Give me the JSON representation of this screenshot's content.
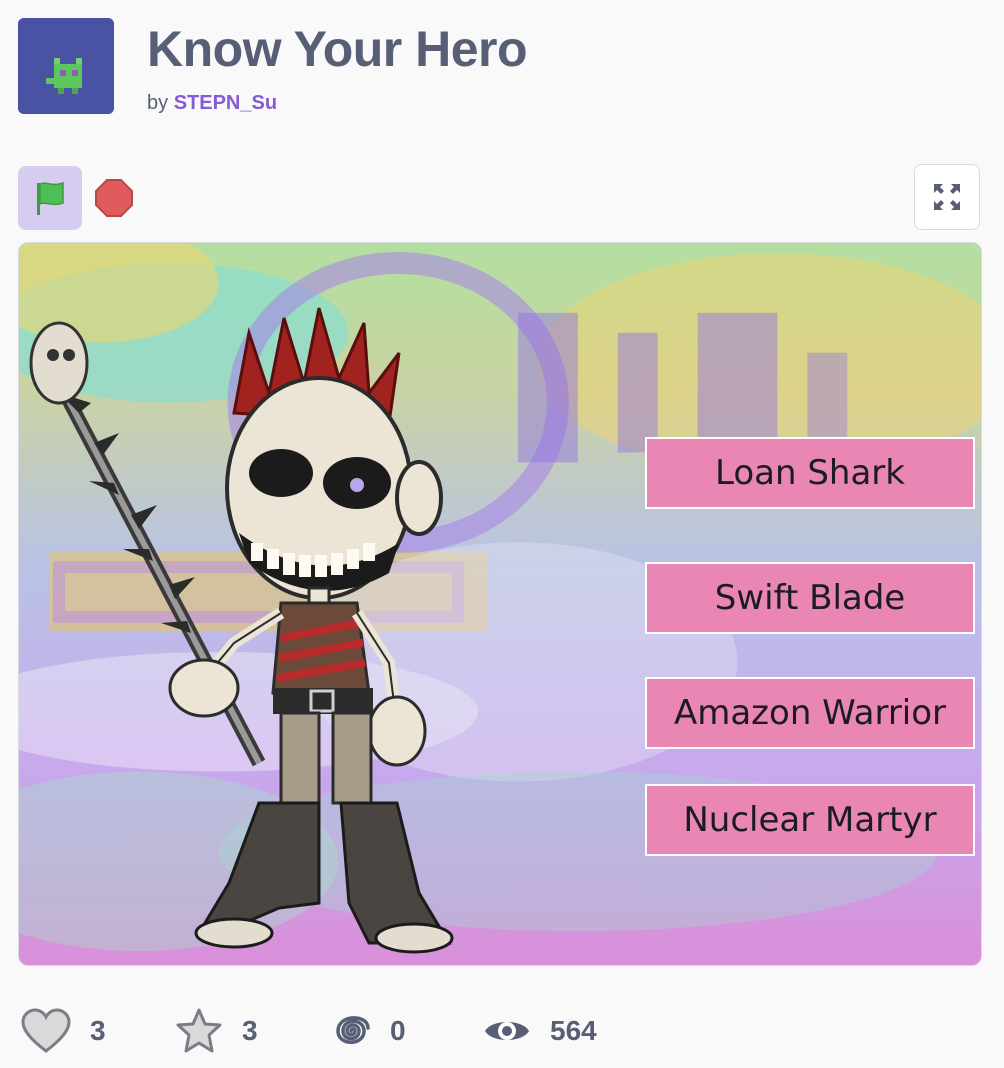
{
  "project": {
    "title": "Know Your Hero",
    "by_label": "by",
    "author": "STEPN_Su",
    "thumbnail_icon": "pixel-cat-icon"
  },
  "controls": {
    "green_flag_icon": "green-flag-icon",
    "stop_icon": "stop-sign-icon",
    "fullscreen_icon": "fullscreen-icon"
  },
  "stage": {
    "choices": [
      "Loan Shark",
      "Swift Blade",
      "Amazon Warrior",
      "Nuclear Martyr"
    ]
  },
  "stats": {
    "loves": "3",
    "favorites": "3",
    "remixes": "0",
    "views": "564"
  },
  "colors": {
    "title": "#575e75",
    "author": "#855cd6",
    "choice_bg": "#ea86b4",
    "flag_bg": "#d6ccf1",
    "stop": "#e05c5c",
    "flag": "#4ab04a"
  }
}
